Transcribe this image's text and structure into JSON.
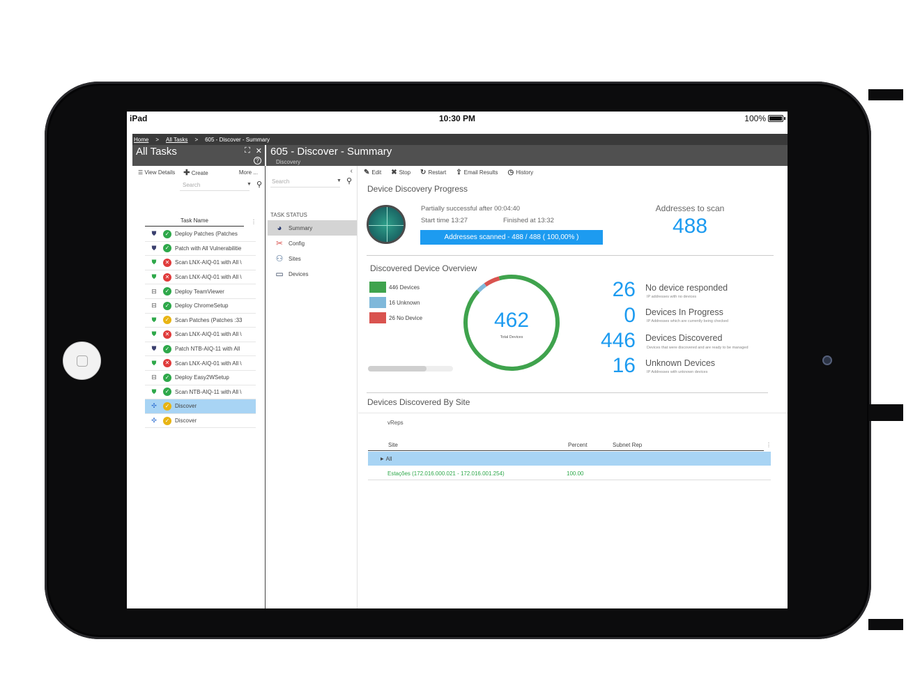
{
  "status_bar": {
    "carrier": "iPad",
    "time": "10:30 PM",
    "battery": "100%"
  },
  "breadcrumb": {
    "home": "Home",
    "sep1": ">",
    "all_tasks": "All Tasks",
    "sep2": ">",
    "current": "605 - Discover - Summary"
  },
  "left_panel": {
    "title": "All Tasks",
    "toolbar": {
      "view_details": "View Details",
      "create": "Create",
      "more": "More ..."
    },
    "search_placeholder": "Search",
    "column_header": "Task Name",
    "tasks": [
      {
        "type": "shield-dark",
        "status": "ok",
        "name": "Deploy Patches (Patches"
      },
      {
        "type": "shield-dark",
        "status": "ok",
        "name": "Patch  with All Vulnerabilitie"
      },
      {
        "type": "shield-green",
        "status": "err",
        "name": "Scan LNX-AIQ-01 with All \\"
      },
      {
        "type": "shield-green",
        "status": "err",
        "name": "Scan LNX-AIQ-01 with All \\"
      },
      {
        "type": "deploy",
        "status": "ok",
        "name": "Deploy TeamViewer"
      },
      {
        "type": "deploy",
        "status": "ok",
        "name": "Deploy ChromeSetup"
      },
      {
        "type": "shield-green",
        "status": "warn",
        "name": "Scan Patches (Patches :33"
      },
      {
        "type": "shield-green",
        "status": "err",
        "name": "Scan LNX-AIQ-01 with All \\"
      },
      {
        "type": "shield-dark",
        "status": "ok",
        "name": "Patch NTB-AIQ-11 with All"
      },
      {
        "type": "shield-green",
        "status": "err",
        "name": "Scan LNX-AIQ-01 with All \\"
      },
      {
        "type": "deploy",
        "status": "ok",
        "name": "Deploy Easy2WSetup"
      },
      {
        "type": "shield-green",
        "status": "ok",
        "name": "Scan NTB-AIQ-11 with All \\"
      },
      {
        "type": "discover",
        "status": "warn",
        "name": "Discover",
        "selected": true
      },
      {
        "type": "discover",
        "status": "warn",
        "name": "Discover"
      }
    ]
  },
  "middle_panel": {
    "search_placeholder": "Search",
    "section_title": "TASK STATUS",
    "items": [
      {
        "label": "Summary",
        "icon": "pie-chart-icon",
        "selected": true
      },
      {
        "label": "Config",
        "icon": "tools-icon"
      },
      {
        "label": "Sites",
        "icon": "sitemap-icon"
      },
      {
        "label": "Devices",
        "icon": "monitor-icon"
      }
    ]
  },
  "main": {
    "title": "605 - Discover - Summary",
    "subtitle": "Discovery",
    "toolbar": {
      "edit": "Edit",
      "stop": "Stop",
      "restart": "Restart",
      "email": "Email Results",
      "history": "History"
    },
    "progress_section": {
      "title": "Device Discovery Progress",
      "status": "Partially successful after 00:04:40",
      "start": "Start time  13:27",
      "finished": "Finished at 13:32",
      "bar_label": "Addresses scanned - 488 / 488 ( 100,00% )",
      "bar_fraction": 1.0,
      "addresses_label": "Addresses to scan",
      "addresses_value": "488"
    },
    "overview": {
      "title": "Discovered Device Overview",
      "legend": [
        {
          "label": "446 Devices",
          "color": "#3fa34d"
        },
        {
          "label": "16 Unknown",
          "color": "#7fb8da"
        },
        {
          "label": "26 No Device",
          "color": "#d9534f"
        }
      ],
      "total": "462",
      "total_label": "Total Devices",
      "donut_segments": [
        {
          "value": 446,
          "color": "#3fa34d"
        },
        {
          "value": 16,
          "color": "#7fb8da"
        },
        {
          "value": 26,
          "color": "#d9534f"
        }
      ],
      "stats": [
        {
          "value": "26",
          "label": "No device responded",
          "desc": "IP addresses with no devices"
        },
        {
          "value": "0",
          "label": "Devices In Progress",
          "desc": "IP Addresses which are currently being checked"
        },
        {
          "value": "446",
          "label": "Devices Discovered",
          "desc": "Devices that were discovered and are ready to be managed"
        },
        {
          "value": "16",
          "label": "Unknown Devices",
          "desc": "IP Addresses with unknown devices"
        }
      ]
    },
    "by_site": {
      "title": "Devices Discovered By Site",
      "tab": "vReps",
      "columns": [
        "Site",
        "Percent",
        "Subnet Rep"
      ],
      "group_label": "All",
      "rows": [
        {
          "site": "Estações (172.016.000.021 - 172.016.001.254)",
          "percent": "100.00",
          "subnet_rep": ""
        }
      ]
    }
  }
}
